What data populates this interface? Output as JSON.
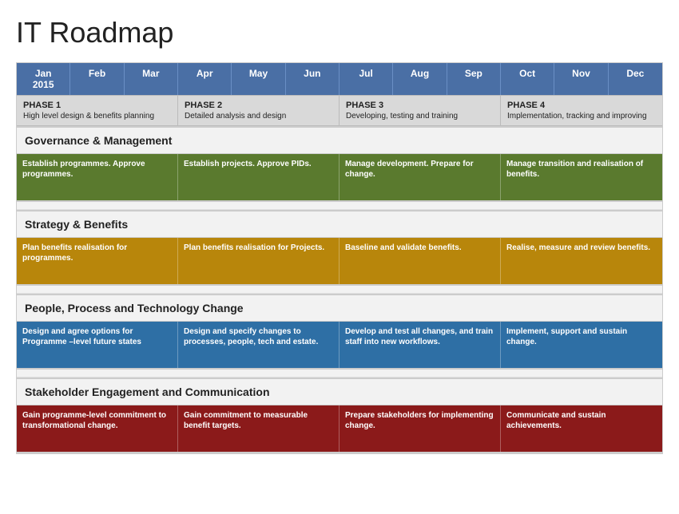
{
  "title": "IT Roadmap",
  "header": {
    "months": [
      {
        "label": "Jan\n2015"
      },
      {
        "label": "Feb"
      },
      {
        "label": "Mar"
      },
      {
        "label": "Apr"
      },
      {
        "label": "May"
      },
      {
        "label": "Jun"
      },
      {
        "label": "Jul"
      },
      {
        "label": "Aug"
      },
      {
        "label": "Sep"
      },
      {
        "label": "Oct"
      },
      {
        "label": "Nov"
      },
      {
        "label": "Dec"
      }
    ]
  },
  "phases": [
    {
      "title": "PHASE 1",
      "desc": "High level design & benefits planning",
      "span": 3
    },
    {
      "title": "PHASE 2",
      "desc": "Detailed analysis and design",
      "span": 3
    },
    {
      "title": "PHASE 3",
      "desc": "Developing, testing and training",
      "span": 3
    },
    {
      "title": "PHASE 4",
      "desc": "Implementation, tracking and improving",
      "span": 3
    }
  ],
  "sections": [
    {
      "label": "Governance & Management",
      "activities": [
        {
          "text": "Establish programmes. Approve programmes.",
          "color": "green",
          "span": 3
        },
        {
          "text": "Establish projects. Approve PIDs.",
          "color": "green",
          "span": 3
        },
        {
          "text": "Manage development. Prepare for change.",
          "color": "green",
          "span": 3
        },
        {
          "text": "Manage transition and realisation of benefits.",
          "color": "green",
          "span": 3
        }
      ]
    },
    {
      "label": "Strategy & Benefits",
      "activities": [
        {
          "text": "Plan benefits realisation for programmes.",
          "color": "yellow",
          "span": 3
        },
        {
          "text": "Plan benefits realisation for Projects.",
          "color": "yellow",
          "span": 3
        },
        {
          "text": "Baseline and validate benefits.",
          "color": "yellow",
          "span": 3
        },
        {
          "text": "Realise, measure and review benefits.",
          "color": "yellow",
          "span": 3
        }
      ]
    },
    {
      "label": "People, Process and Technology Change",
      "activities": [
        {
          "text": "Design and agree options for Programme –level future states",
          "color": "blue",
          "span": 3
        },
        {
          "text": "Design and specify changes to processes, people, tech and estate.",
          "color": "blue",
          "span": 3
        },
        {
          "text": "Develop and test all changes, and train staff into new workflows.",
          "color": "blue",
          "span": 3
        },
        {
          "text": "Implement, support and sustain change.",
          "color": "blue",
          "span": 3
        }
      ]
    },
    {
      "label": "Stakeholder Engagement and Communication",
      "activities": [
        {
          "text": "Gain programme-level commitment to transformational change.",
          "color": "red",
          "span": 3
        },
        {
          "text": "Gain commitment to measurable benefit targets.",
          "color": "red",
          "span": 3
        },
        {
          "text": "Prepare stakeholders for implementing change.",
          "color": "red",
          "span": 3
        },
        {
          "text": "Communicate and sustain achievements.",
          "color": "red",
          "span": 3
        }
      ]
    }
  ]
}
